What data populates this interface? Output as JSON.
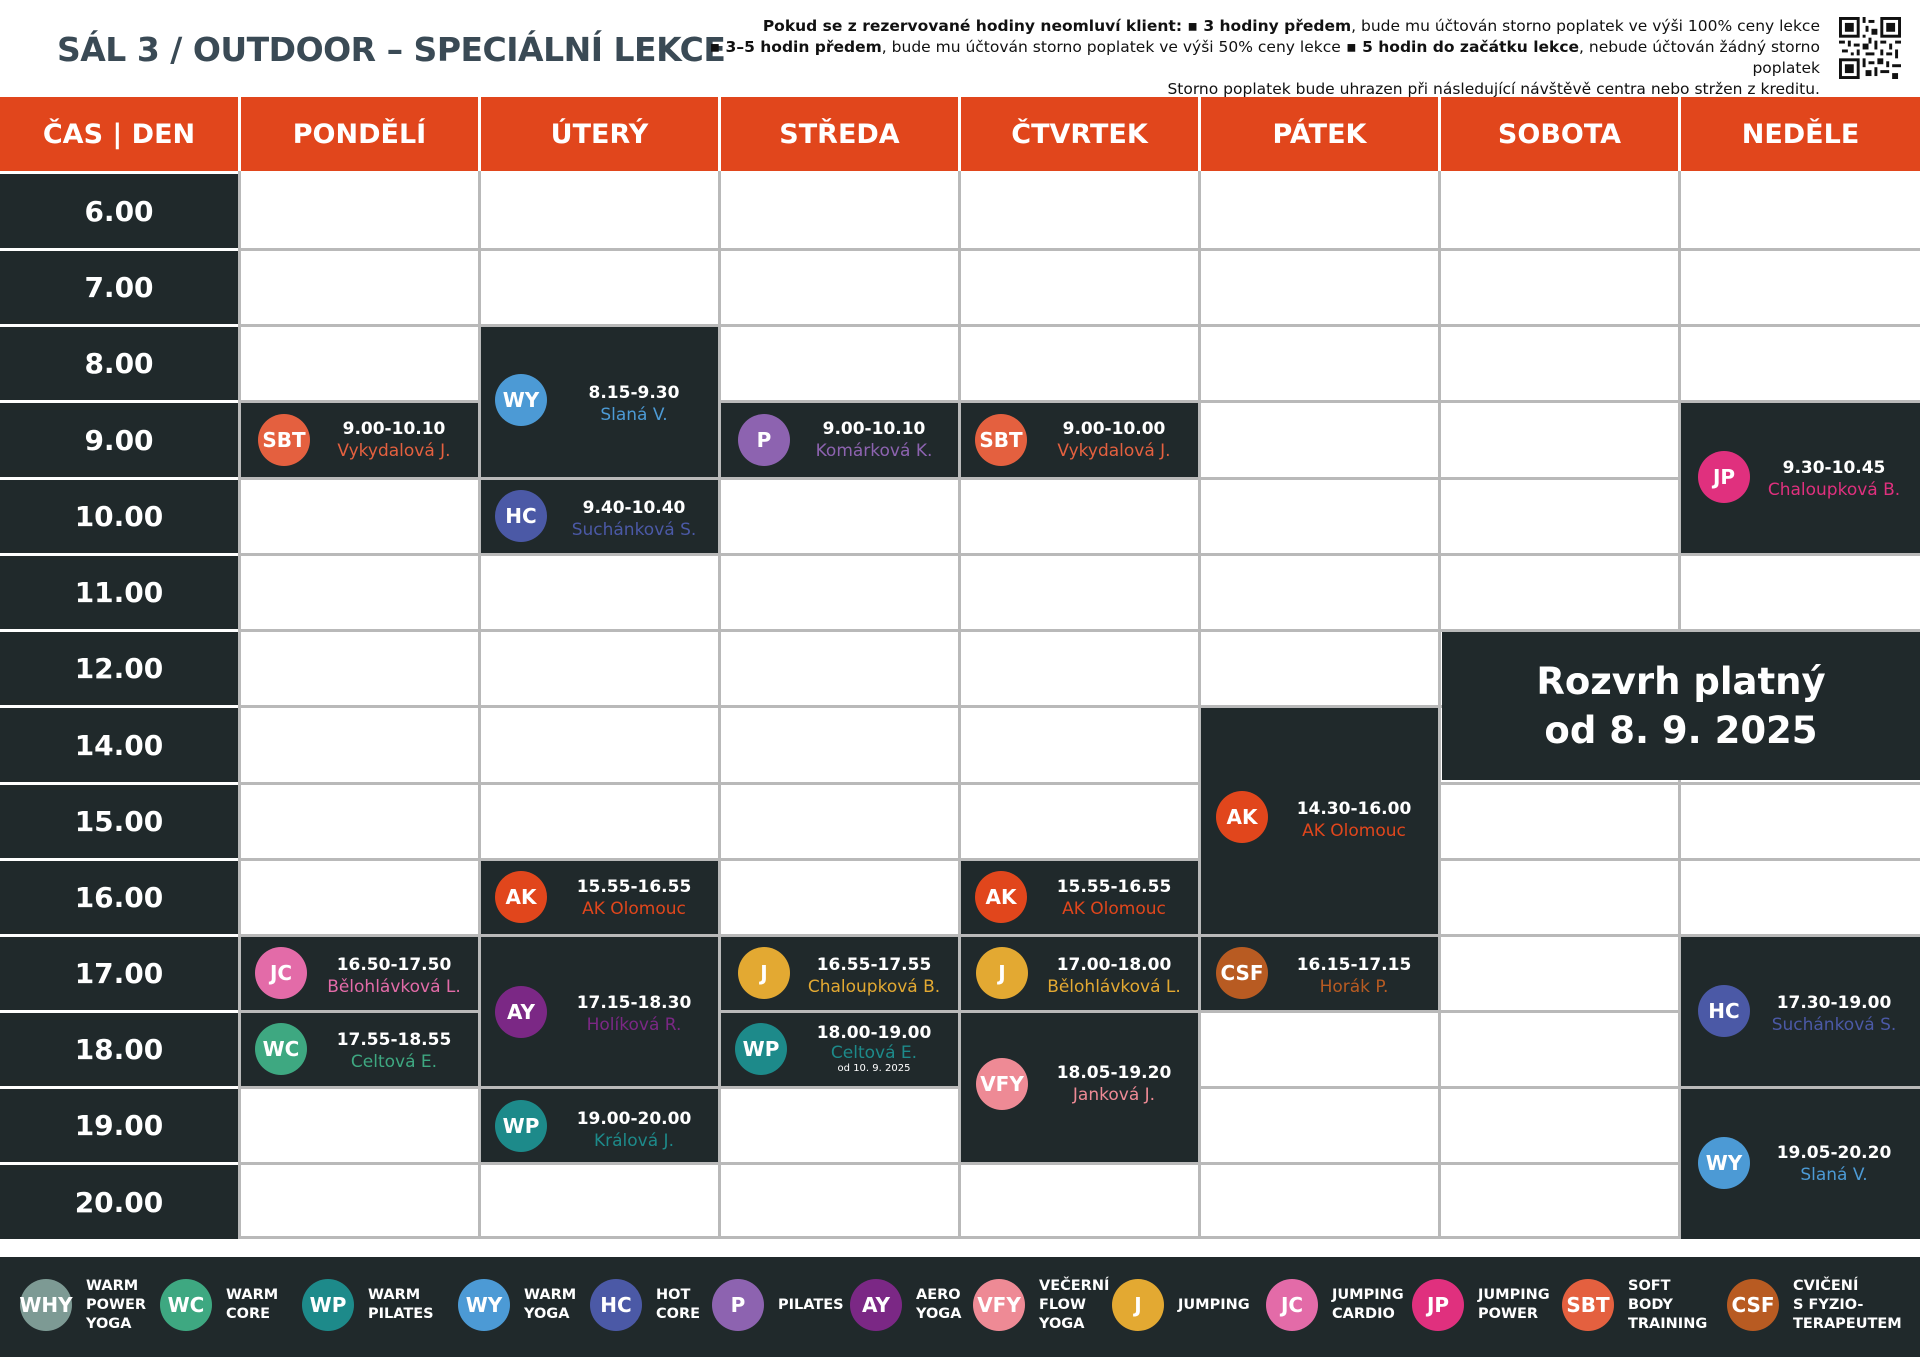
{
  "title": "SÁL  3 / OUTDOOR – SPECIÁLNÍ LEKCE",
  "notice": {
    "line1_bold": "Pokud se z rezervované hodiny neomluví klient:",
    "line1_b2": " ▪ 3 hodiny předem",
    "line1_rest": ", bude mu účtován storno poplatek ve výši 100% ceny lekce",
    "line2_b1": "▪ 3–5 hodin předem",
    "line2_mid": ", bude mu účtován storno poplatek ve výši 50% ceny lekce",
    "line2_b2": " ▪ 5 hodin do začátku lekce",
    "line2_rest": ", nebude účtován žádný storno poplatek",
    "line3": "Storno poplatek bude uhrazen při následující návštěvě centra nebo stržen z kreditu."
  },
  "header": {
    "corner": "ČAS | DEN",
    "days": [
      "PONDĚLÍ",
      "ÚTERÝ",
      "STŘEDA",
      "ČTVRTEK",
      "PÁTEK",
      "SOBOTA",
      "NEDĚLE"
    ]
  },
  "times": [
    "6.00",
    "7.00",
    "8.00",
    "9.00",
    "10.00",
    "11.00",
    "12.00",
    "14.00",
    "15.00",
    "16.00",
    "17.00",
    "18.00",
    "19.00",
    "20.00"
  ],
  "colors": {
    "accent": "#e1461c",
    "dark": "#20292b",
    "SBT": "#e4603f",
    "WY": "#4c9ad5",
    "HC": "#4b59a6",
    "P": "#8d63b0",
    "JP": "#e0307e",
    "AK": "#e1461c",
    "JC": "#e36ba8",
    "WC": "#3ea881",
    "AY": "#7b2885",
    "J": "#e3a932",
    "CSF": "#b85b22",
    "WP": "#1d8a8a",
    "VFY": "#ee8a95",
    "WHY": "#7d9a94"
  },
  "lessons": [
    {
      "code": "SBT",
      "time": "9.00-10.10",
      "instructor": "Vykydalová J.",
      "note": ""
    },
    {
      "code": "WY",
      "time": "8.15-9.30",
      "instructor": "Slaná V.",
      "note": ""
    },
    {
      "code": "HC",
      "time": "9.40-10.40",
      "instructor": "Suchánková S.",
      "note": ""
    },
    {
      "code": "P",
      "time": "9.00-10.10",
      "instructor": "Komárková K.",
      "note": ""
    },
    {
      "code": "SBT",
      "time": "9.00-10.00",
      "instructor": "Vykydalová J.",
      "note": ""
    },
    {
      "code": "JP",
      "time": "9.30-10.45",
      "instructor": "Chaloupková B.",
      "note": ""
    },
    {
      "code": "AK",
      "time": "14.30-16.00",
      "instructor": "AK Olomouc",
      "note": ""
    },
    {
      "code": "AK",
      "time": "15.55-16.55",
      "instructor": "AK Olomouc",
      "note": ""
    },
    {
      "code": "AK",
      "time": "15.55-16.55",
      "instructor": "AK Olomouc",
      "note": ""
    },
    {
      "code": "JC",
      "time": "16.50-17.50",
      "instructor": "Bělohlávková L.",
      "note": ""
    },
    {
      "code": "WC",
      "time": "17.55-18.55",
      "instructor": "Celtová E.",
      "note": ""
    },
    {
      "code": "AY",
      "time": "17.15-18.30",
      "instructor": "Holíková R.",
      "note": ""
    },
    {
      "code": "WP",
      "time": "19.00-20.00",
      "instructor": "Králová J.",
      "note": ""
    },
    {
      "code": "J",
      "time": "16.55-17.55",
      "instructor": "Chaloupková B.",
      "note": ""
    },
    {
      "code": "WP",
      "time": "18.00-19.00",
      "instructor": "Celtová E.",
      "note": "od 10. 9. 2025"
    },
    {
      "code": "J",
      "time": "17.00-18.00",
      "instructor": "Bělohlávková L.",
      "note": ""
    },
    {
      "code": "VFY",
      "time": "18.05-19.20",
      "instructor": "Janková J.",
      "note": ""
    },
    {
      "code": "CSF",
      "time": "16.15-17.15",
      "instructor": "Horák P.",
      "note": ""
    },
    {
      "code": "HC",
      "time": "17.30-19.00",
      "instructor": "Suchánková S.",
      "note": ""
    },
    {
      "code": "WY",
      "time": "19.05-20.20",
      "instructor": "Slaná V.",
      "note": ""
    }
  ],
  "valid_from": {
    "line1": "Rozvrh platný",
    "line2": "od 8. 9. 2025"
  },
  "legend": [
    {
      "code": "WHY",
      "label": "WARM\nPOWER\nYOGA"
    },
    {
      "code": "WC",
      "label": "WARM\nCORE"
    },
    {
      "code": "WP",
      "label": "WARM\nPILATES"
    },
    {
      "code": "WY",
      "label": "WARM\nYOGA"
    },
    {
      "code": "HC",
      "label": "HOT\nCORE"
    },
    {
      "code": "P",
      "label": "PILATES"
    },
    {
      "code": "AY",
      "label": "AERO\nYOGA"
    },
    {
      "code": "VFY",
      "label": "VEČERNÍ\nFLOW\nYOGA"
    },
    {
      "code": "J",
      "label": "JUMPING"
    },
    {
      "code": "JC",
      "label": "JUMPING\nCARDIO"
    },
    {
      "code": "JP",
      "label": "JUMPING\nPOWER"
    },
    {
      "code": "SBT",
      "label": "SOFT BODY\nTRAINING"
    },
    {
      "code": "CSF",
      "label": "CVIČENÍ\nS FYZIO-\nTERAPEUTEM"
    }
  ]
}
